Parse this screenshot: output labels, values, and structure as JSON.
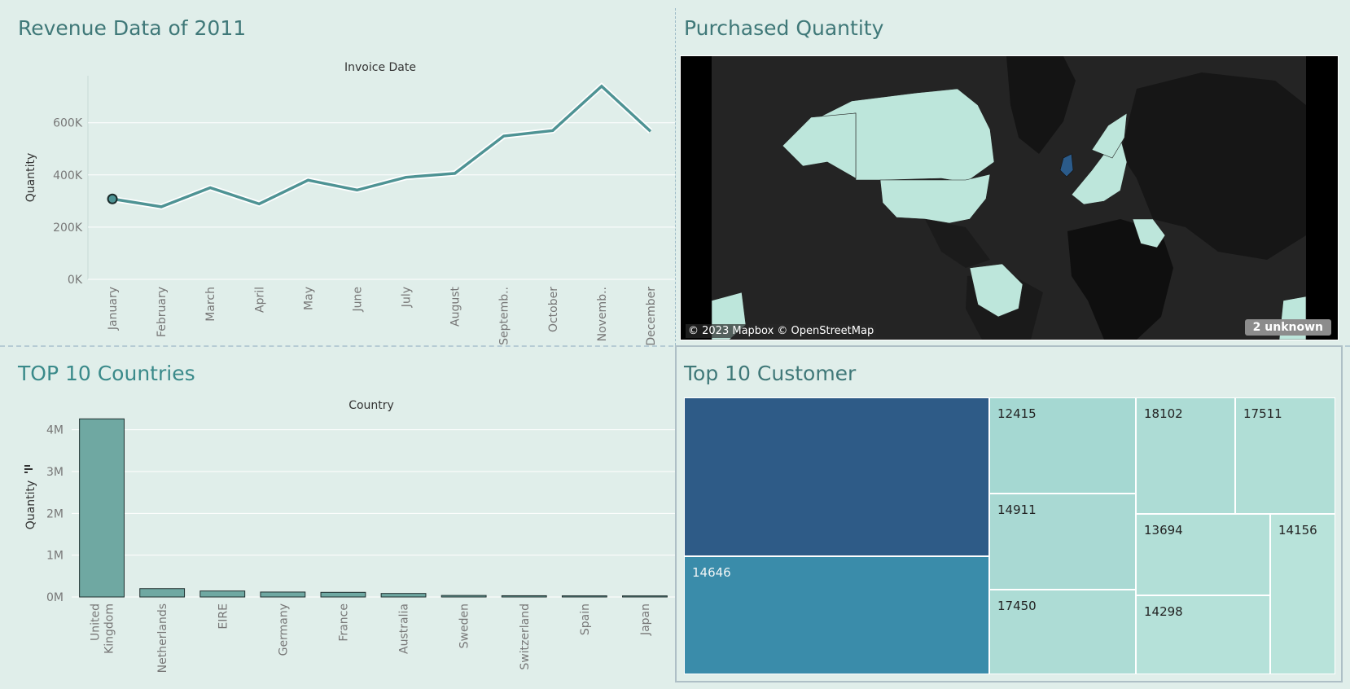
{
  "revenue": {
    "title": "Revenue Data of 2011",
    "chart_data": {
      "type": "line",
      "title": "Invoice Date",
      "ylabel": "Quantity",
      "xlabel": "",
      "categories": [
        "January",
        "February",
        "March",
        "April",
        "May",
        "June",
        "July",
        "August",
        "Septemb..",
        "October",
        "Novemb..",
        "December"
      ],
      "values": [
        308000,
        278000,
        351000,
        289000,
        380000,
        342000,
        391000,
        406000,
        549000,
        570000,
        740000,
        567000
      ],
      "ylim": [
        0,
        780000
      ],
      "yticks": [
        0,
        200000,
        400000,
        600000
      ],
      "ytick_labels": [
        "0K",
        "200K",
        "400K",
        "600K"
      ],
      "grid": true,
      "line_color": "#4e9394",
      "highlighted_point": "January"
    }
  },
  "map": {
    "title": "Purchased Quantity",
    "attribution": "© 2023 Mapbox © OpenStreetMap",
    "unknown_badge": "2 unknown",
    "base_color": "#242424",
    "land_color": "#2f2f2f",
    "highlight_color": "#bde6db",
    "top_country_color": "#2b5b8a"
  },
  "countries": {
    "title": "TOP 10 Countries",
    "chart_data": {
      "type": "bar",
      "title": "Country",
      "ylabel": "Quantity",
      "xlabel": "",
      "categories": [
        "United Kingdom",
        "Netherlands",
        "EIRE",
        "Germany",
        "France",
        "Australia",
        "Sweden",
        "Switzerland",
        "Spain",
        "Japan"
      ],
      "values": [
        4260000,
        200000,
        143000,
        118000,
        111000,
        84000,
        36000,
        30000,
        27000,
        26000
      ],
      "ylim": [
        0,
        4500000
      ],
      "yticks": [
        0,
        1000000,
        2000000,
        3000000,
        4000000
      ],
      "ytick_labels": [
        "0M",
        "1M",
        "2M",
        "3M",
        "4M"
      ],
      "grid": true,
      "bar_color": "#6fa8a2"
    }
  },
  "customers": {
    "title": "Top 10 Customer",
    "chart_data": {
      "type": "treemap",
      "items": [
        {
          "name": "",
          "color": "#2e5b87"
        },
        {
          "name": "14646",
          "color": "#3a8caa"
        },
        {
          "name": "12415",
          "color": "#a5d8d2"
        },
        {
          "name": "14911",
          "color": "#a9d9d3"
        },
        {
          "name": "17450",
          "color": "#addcd5"
        },
        {
          "name": "18102",
          "color": "#addcd5"
        },
        {
          "name": "17511",
          "color": "#b0ded6"
        },
        {
          "name": "13694",
          "color": "#b2dfd7"
        },
        {
          "name": "14298",
          "color": "#b5e1d9"
        },
        {
          "name": "14156",
          "color": "#b8e3da"
        }
      ]
    }
  }
}
